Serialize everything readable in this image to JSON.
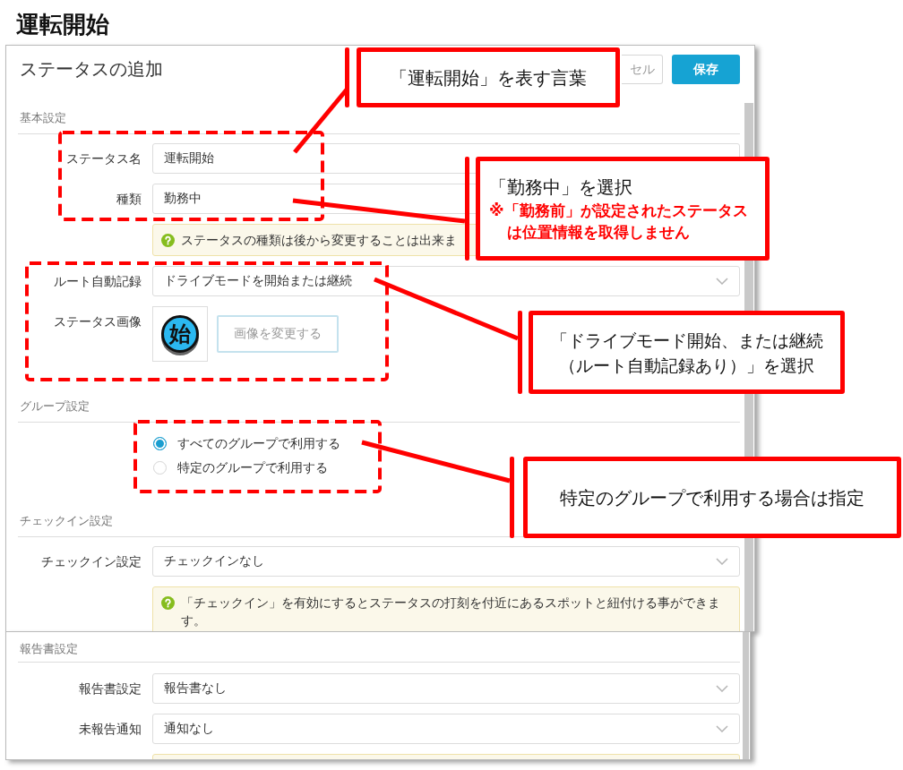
{
  "page_title": "運転開始",
  "dialog": {
    "title": "ステータスの追加",
    "buttons": [
      {
        "kind": "secondary",
        "label": "セル"
      },
      {
        "kind": "primary",
        "label": "保存"
      }
    ],
    "sections": [
      {
        "heading": "基本設定",
        "rows": [
          {
            "kind": "input",
            "label": "ステータス名",
            "value": "運転開始"
          },
          {
            "kind": "input",
            "label": "種類",
            "value": "勤務中"
          },
          {
            "kind": "note",
            "text": "ステータスの種類は後から変更することは出来ま"
          },
          {
            "kind": "select",
            "label": "ルート自動記録",
            "value": "ドライブモードを開始または継続"
          },
          {
            "kind": "image",
            "label": "ステータス画像",
            "badge": "始",
            "button": "画像を変更する"
          }
        ]
      },
      {
        "heading": "グループ設定",
        "rows": [
          {
            "kind": "radio",
            "options": [
              {
                "label": "すべてのグループで利用する",
                "selected": true
              },
              {
                "label": "特定のグループで利用する",
                "selected": false
              }
            ]
          }
        ]
      },
      {
        "heading": "チェックイン設定",
        "rows": [
          {
            "kind": "select",
            "label": "チェックイン設定",
            "value": "チェックインなし"
          },
          {
            "kind": "note",
            "text": "「チェックイン」を有効にするとステータスの打刻を付近にあるスポットと紐付ける事ができます。"
          }
        ]
      }
    ]
  },
  "dialog_continued": {
    "sections": [
      {
        "heading": "報告書設定",
        "rows": [
          {
            "kind": "select",
            "label": "報告書設定",
            "value": "報告書なし"
          },
          {
            "kind": "select",
            "label": "未報告通知",
            "value": "通知なし"
          },
          {
            "kind": "note"
          }
        ]
      }
    ]
  },
  "callouts": [
    {
      "text": "「運転開始」を表す言葉"
    },
    {
      "text": "「勤務中」を選択",
      "note": "※「勤務前」が設定されたステータスは位置情報を取得しません"
    },
    {
      "text": "「ドライブモード開始、または継続（ルート自動記録あり）」を選択"
    },
    {
      "text": "特定のグループで利用する場合は指定"
    }
  ]
}
